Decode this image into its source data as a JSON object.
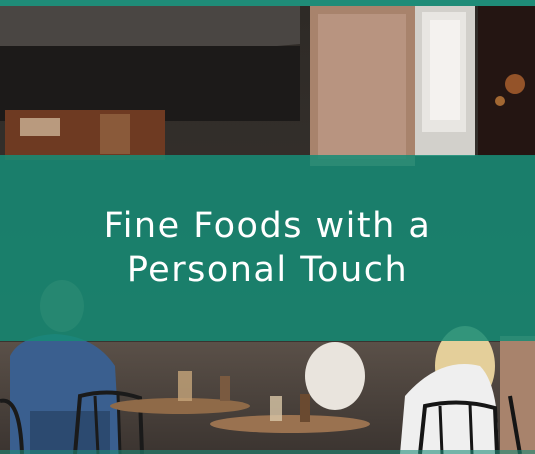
{
  "hero": {
    "headline_line1": "Fine Foods with a",
    "headline_line2": "Personal Touch",
    "background_image": "outdoor cafe patio with people dining at tables",
    "colors": {
      "accent": "#1f8c78",
      "overlay": "#168c76",
      "text": "#ffffff"
    }
  }
}
